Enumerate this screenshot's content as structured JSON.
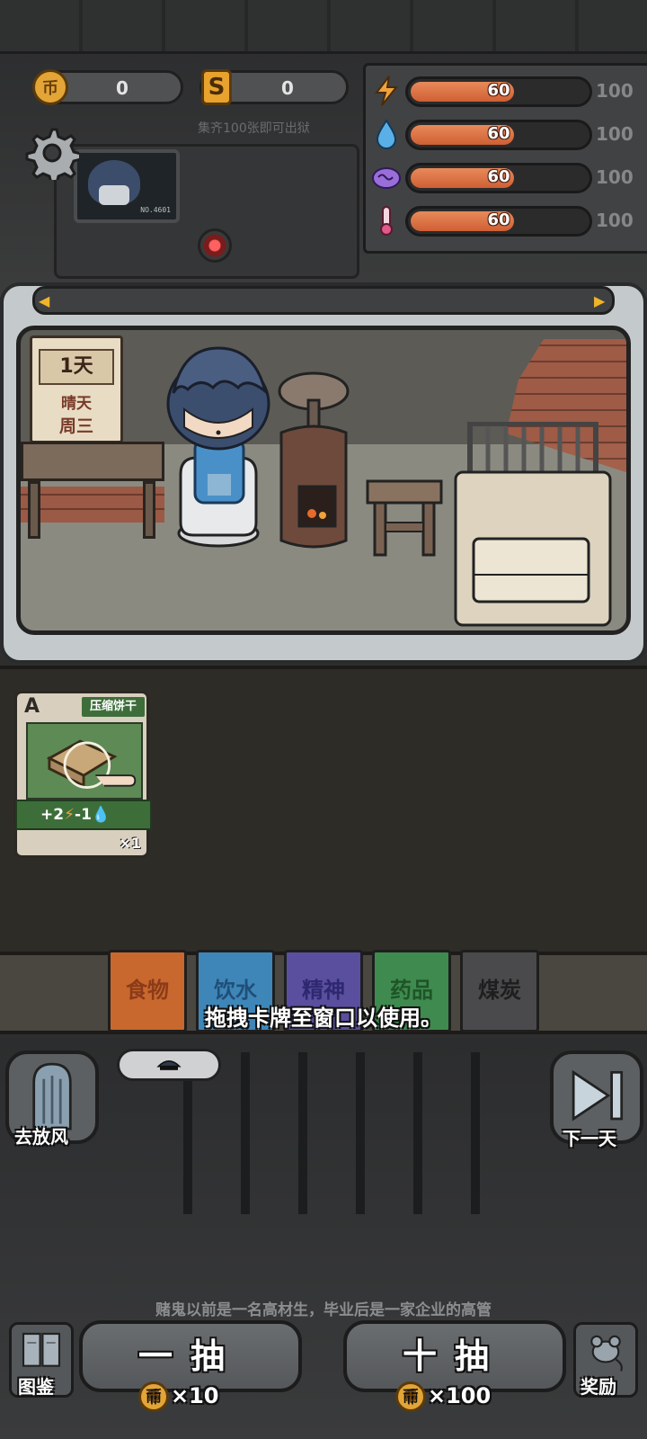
{
  "currency": {
    "coins": "0",
    "coin_symbol": "币",
    "tokens": "0",
    "token_symbol": "S"
  },
  "collect_hint": "集齐100张即可出狱",
  "monitor_id": "NO.4601",
  "stats": [
    {
      "icon": "lightning-icon",
      "value": "60",
      "max": "100",
      "level": 0.6,
      "color": "#f0a23a"
    },
    {
      "icon": "water-drop-icon",
      "value": "60",
      "max": "100",
      "level": 0.6,
      "color": "#5ab0e6"
    },
    {
      "icon": "brain-icon",
      "value": "60",
      "max": "100",
      "level": 0.6,
      "color": "#9a6ed8"
    },
    {
      "icon": "thermometer-icon",
      "value": "60",
      "max": "100",
      "level": 0.6,
      "color": "#e05a8a"
    }
  ],
  "calendar": {
    "day": "1天",
    "weather": "晴天",
    "weekday": "周三"
  },
  "card": {
    "rank": "A",
    "name": "压缩饼干",
    "effect": "+2⚡-1💧",
    "effect_plus": "+2",
    "effect_minus": "-1",
    "count": "×1"
  },
  "categories": [
    {
      "label": "食物",
      "bg": "#c8682e",
      "fg": "#8b3b18"
    },
    {
      "label": "饮水",
      "bg": "#3f86b8",
      "fg": "#1f4f78"
    },
    {
      "label": "精神",
      "bg": "#5a4f9e",
      "fg": "#2e2870"
    },
    {
      "label": "药品",
      "bg": "#3f8a4e",
      "fg": "#1f5428"
    },
    {
      "label": "煤炭",
      "bg": "#4a4a4c",
      "fg": "#1e1e1e"
    }
  ],
  "hint": "拖拽卡牌至窗口以使用。",
  "buttons": {
    "go_out": "去放风",
    "next_day": "下一天",
    "catalog": "图鉴",
    "reward": "奖励",
    "draw_one": "一抽",
    "draw_ten": "十抽",
    "draw_one_price": "×10",
    "draw_ten_price": "×100"
  },
  "story": "赌鬼以前是一名高材生，毕业后是一家企业的高管"
}
